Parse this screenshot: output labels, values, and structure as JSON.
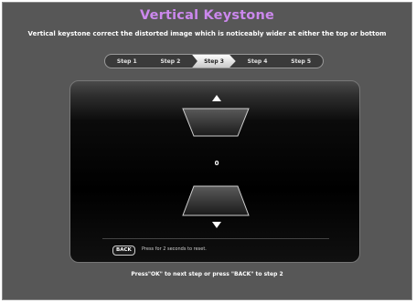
{
  "title": "Vertical Keystone",
  "subtitle": "Vertical keystone correct the distorted image which is noticeably wider at either the top or bottom",
  "steps": [
    {
      "label": "Step 1",
      "active": false
    },
    {
      "label": "Step 2",
      "active": false
    },
    {
      "label": "Step 3",
      "active": true
    },
    {
      "label": "Step 4",
      "active": false
    },
    {
      "label": "Step 5",
      "active": false
    }
  ],
  "keystone": {
    "value": "0",
    "icons": [
      "up-arrow-icon",
      "down-arrow-icon"
    ]
  },
  "reset": {
    "button_label": "BACK",
    "hint": "Press for 2 seconds to reset."
  },
  "footer": "Press\"OK\" to next step or press \"BACK\" to step 2",
  "colors": {
    "title": "#cc88ee",
    "background": "#575757",
    "panel": "#000000"
  }
}
